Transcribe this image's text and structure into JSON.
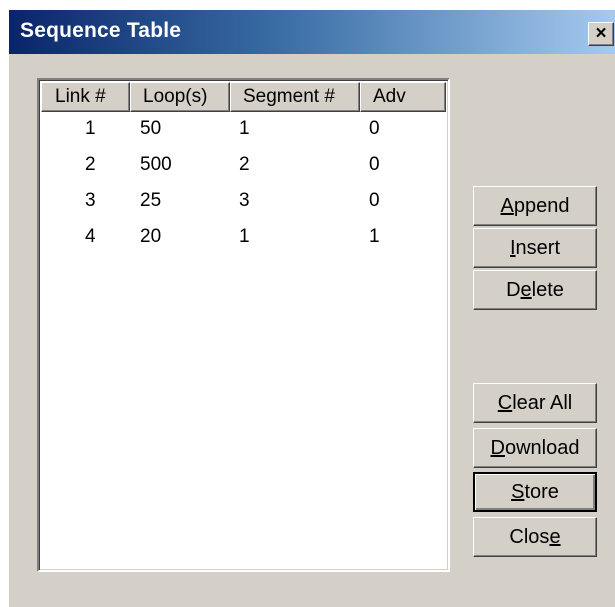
{
  "window": {
    "title": "Sequence Table",
    "close_label": "×"
  },
  "table": {
    "columns": [
      "Link #",
      "Loop(s)",
      "Segment #",
      "Adv"
    ],
    "rows": [
      [
        "1",
        "50",
        "1",
        "0"
      ],
      [
        "2",
        "500",
        "2",
        "0"
      ],
      [
        "3",
        "25",
        "3",
        "0"
      ],
      [
        "4",
        "20",
        "1",
        "1"
      ]
    ]
  },
  "buttons": {
    "append": {
      "before": "",
      "accel": "A",
      "after": "ppend"
    },
    "insert": {
      "before": "",
      "accel": "I",
      "after": "nsert"
    },
    "delete": {
      "before": "D",
      "accel": "e",
      "after": "lete"
    },
    "clear_all": {
      "before": "",
      "accel": "C",
      "after": "lear All"
    },
    "download": {
      "before": "",
      "accel": "D",
      "after": "ownload"
    },
    "store": {
      "before": "",
      "accel": "S",
      "after": "tore"
    },
    "close": {
      "before": "Clos",
      "accel": "e",
      "after": ""
    }
  }
}
